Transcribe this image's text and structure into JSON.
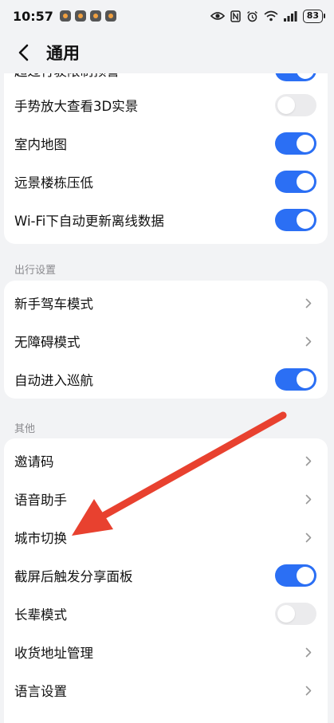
{
  "status_bar": {
    "time": "10:57",
    "battery": "83"
  },
  "header": {
    "title": "通用"
  },
  "group1": {
    "partial_item": "超过行驶限制预警",
    "items": [
      {
        "label": "手势放大查看3D实景",
        "control": "toggle",
        "on": false
      },
      {
        "label": "室内地图",
        "control": "toggle",
        "on": true
      },
      {
        "label": "远景楼栋压低",
        "control": "toggle",
        "on": true
      },
      {
        "label": "Wi-Fi下自动更新离线数据",
        "control": "toggle",
        "on": true
      }
    ]
  },
  "section_travel": {
    "title": "出行设置",
    "items": [
      {
        "label": "新手驾车模式",
        "control": "chevron"
      },
      {
        "label": "无障碍模式",
        "control": "chevron"
      },
      {
        "label": "自动进入巡航",
        "control": "toggle",
        "on": true
      }
    ]
  },
  "section_other": {
    "title": "其他",
    "items": [
      {
        "label": "邀请码",
        "control": "chevron"
      },
      {
        "label": "语音助手",
        "control": "chevron"
      },
      {
        "label": "城市切换",
        "control": "chevron"
      },
      {
        "label": "截屏后触发分享面板",
        "control": "toggle",
        "on": true
      },
      {
        "label": "长辈模式",
        "control": "toggle",
        "on": false
      },
      {
        "label": "收货地址管理",
        "control": "chevron"
      },
      {
        "label": "语言设置",
        "control": "chevron"
      }
    ]
  },
  "colors": {
    "accent": "#2b6ff4",
    "annotation_arrow": "#e8412f",
    "background": "#f2f3f5"
  }
}
